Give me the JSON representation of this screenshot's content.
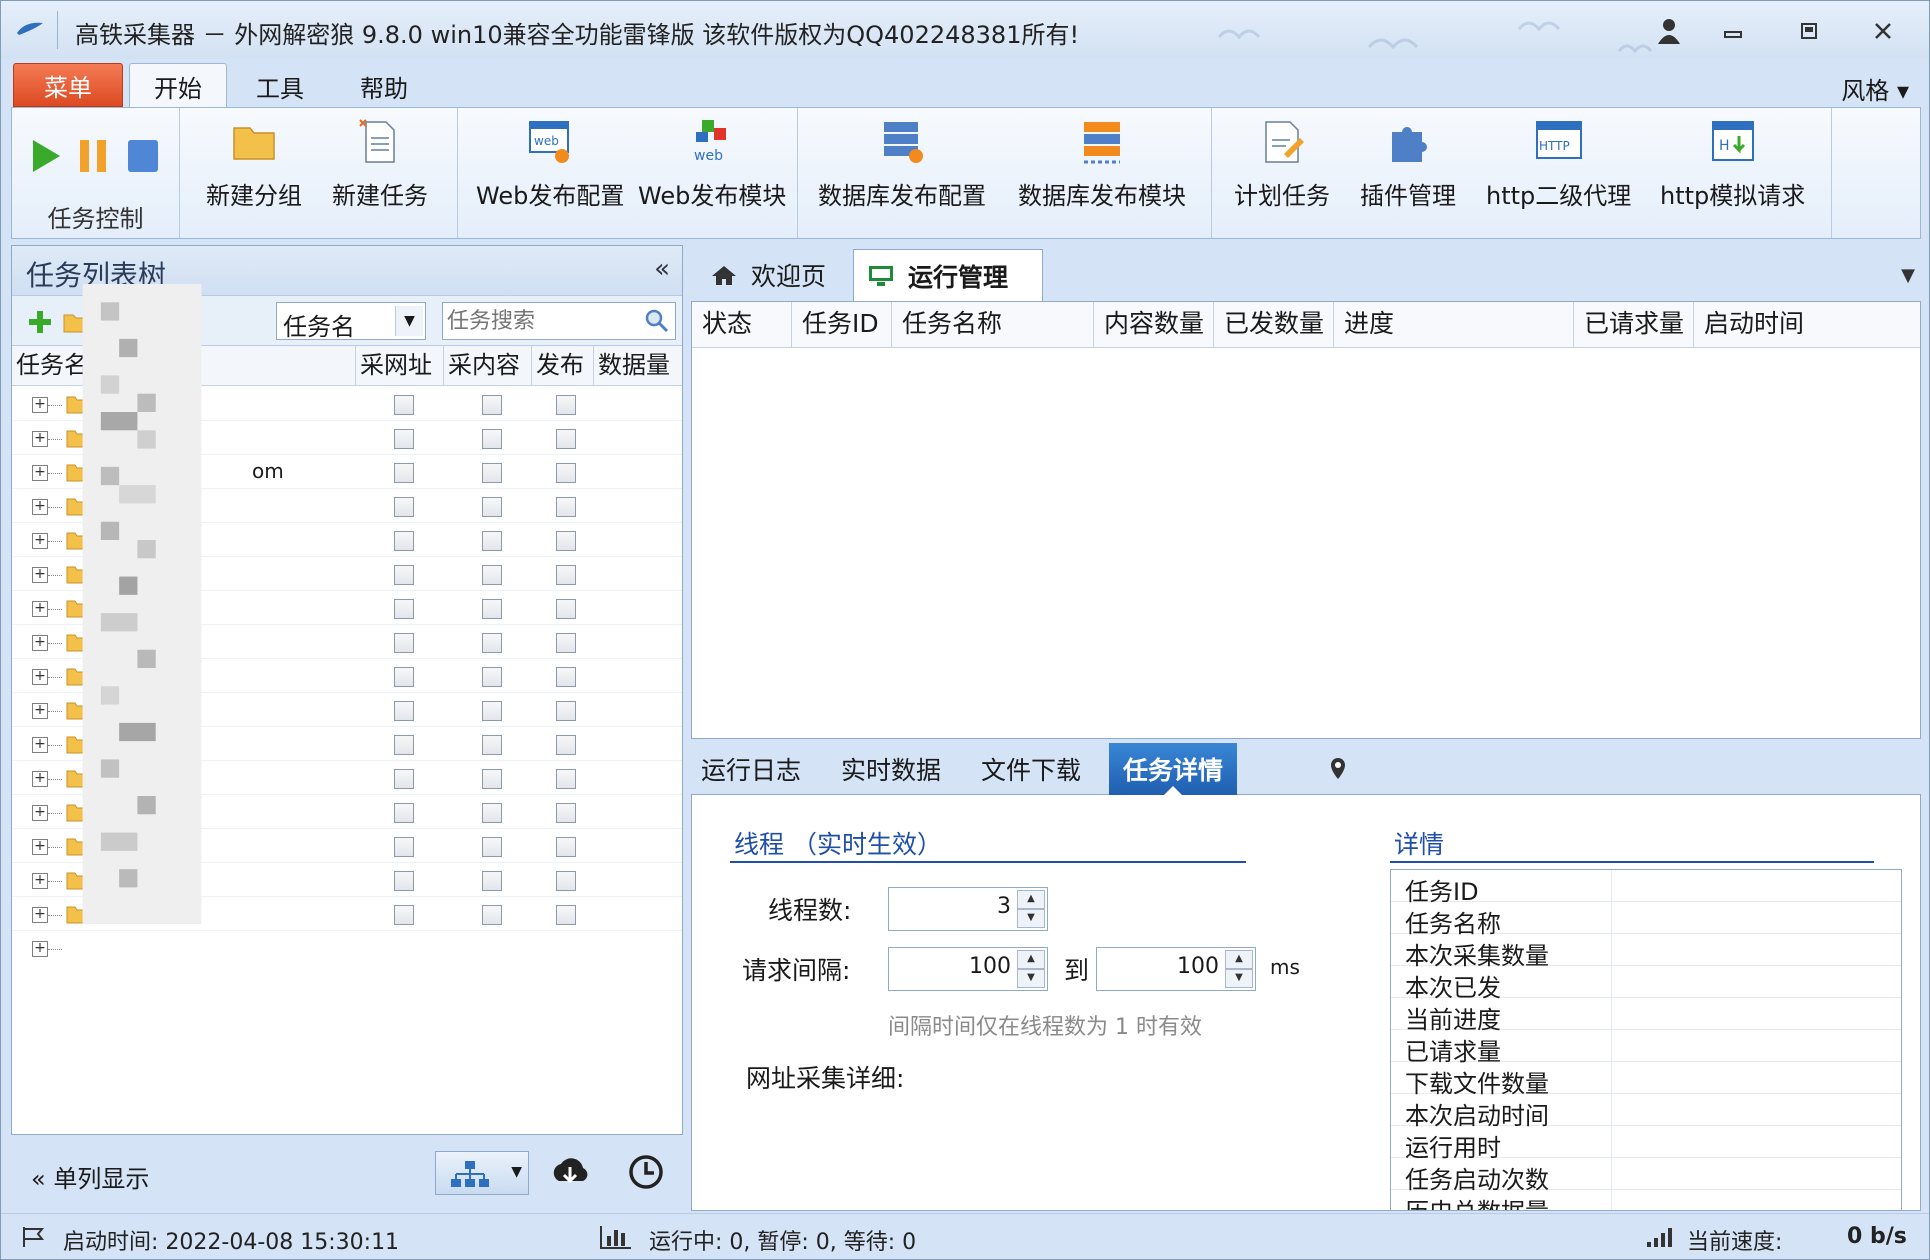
{
  "titlebar": {
    "title": "高铁采集器 － 外网解密狼 9.8.0 win10兼容全功能雷锋版  该软件版权为QQ402248381所有!"
  },
  "ribbon_tabs": {
    "menu": "菜单",
    "tabs": [
      "开始",
      "工具",
      "帮助"
    ],
    "style": "风格 ▾"
  },
  "ribbon": {
    "task_control_caption": "任务控制",
    "buttons": [
      {
        "label": "新建分组",
        "icon": "folder-icon"
      },
      {
        "label": "新建任务",
        "icon": "new-document-icon"
      },
      {
        "label": "Web发布配置",
        "icon": "web-config-icon"
      },
      {
        "label": "Web发布模块",
        "icon": "web-module-icon"
      },
      {
        "label": "数据库发布配置",
        "icon": "database-config-icon"
      },
      {
        "label": "数据库发布模块",
        "icon": "database-module-icon"
      },
      {
        "label": "计划任务",
        "icon": "schedule-icon"
      },
      {
        "label": "插件管理",
        "icon": "plugin-icon"
      },
      {
        "label": "http二级代理",
        "icon": "http-icon"
      },
      {
        "label": "http模拟请求",
        "icon": "http-request-icon"
      }
    ]
  },
  "left_panel": {
    "title": "任务列表树",
    "collapse": "«",
    "filter_field": "任务名",
    "search_placeholder": "任务搜索",
    "columns": [
      "任务名",
      "采网址",
      "采内容",
      "发布",
      "数据量"
    ],
    "row_partial_text": "om",
    "single_column": "单列显示"
  },
  "doc_tabs": {
    "tabs": [
      "欢迎页",
      "运行管理"
    ]
  },
  "run_grid": {
    "columns": [
      "状态",
      "任务ID",
      "任务名称",
      "内容数量",
      "已发数量",
      "进度",
      "已请求量",
      "启动时间"
    ]
  },
  "sub_tabs": {
    "tabs": [
      "运行日志",
      "实时数据",
      "文件下载",
      "任务详情"
    ]
  },
  "details": {
    "thread_section": "线程 （实时生效）",
    "thread_label": "线程数:",
    "thread_value": "3",
    "interval_label": "请求间隔:",
    "interval_from": "100",
    "to_label": "到",
    "interval_to": "100",
    "unit": "ms",
    "hint": "间隔时间仅在线程数为 1 时有效",
    "url_detail_label": "网址采集详细:",
    "detail_section": "详情",
    "detail_items": [
      "任务ID",
      "任务名称",
      "本次采集数量",
      "本次已发",
      "当前进度",
      "已请求量",
      "下载文件数量",
      "本次启动时间",
      "运行用时",
      "任务启动次数",
      "历史总数据量"
    ]
  },
  "statusbar": {
    "start_time": "启动时间:  2022-04-08 15:30:11",
    "counts": "运行中: 0,  暂停: 0,  等待: 0",
    "speed_label": "当前速度:",
    "speed_value": "0 b/s"
  },
  "colors": {
    "accent": "#1f4fa8",
    "menu": "#e35a30",
    "active_subtab": "#2a72c4"
  }
}
